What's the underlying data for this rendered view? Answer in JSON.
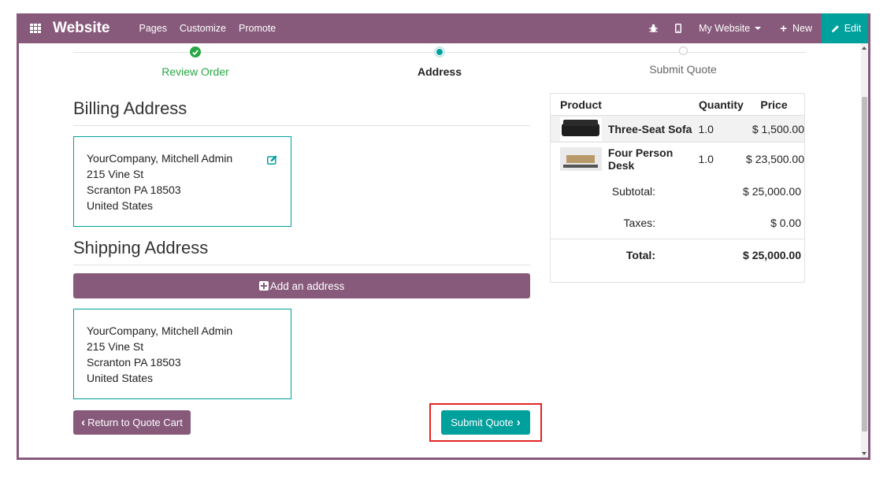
{
  "navbar": {
    "brand": "Website",
    "links": [
      "Pages",
      "Customize",
      "Promote"
    ],
    "site_select": "My Website",
    "new_label": "New",
    "edit_label": "Edit"
  },
  "steps": [
    {
      "label": "Review Order",
      "state": "done"
    },
    {
      "label": "Address",
      "state": "active"
    },
    {
      "label": "Submit Quote",
      "state": "todo"
    }
  ],
  "billing": {
    "title": "Billing Address",
    "lines": [
      "YourCompany, Mitchell Admin",
      "215 Vine St",
      "Scranton PA 18503",
      "United States"
    ]
  },
  "shipping": {
    "title": "Shipping Address",
    "add_label": "Add an address",
    "lines": [
      "YourCompany, Mitchell Admin",
      "215 Vine St",
      "Scranton PA 18503",
      "United States"
    ]
  },
  "actions": {
    "return_label": "Return to Quote Cart",
    "submit_label": "Submit Quote"
  },
  "summary": {
    "headers": {
      "product": "Product",
      "quantity": "Quantity",
      "price": "Price"
    },
    "items": [
      {
        "name": "Three-Seat Sofa",
        "qty": "1.0",
        "price": "$ 1,500.00"
      },
      {
        "name": "Four Person Desk",
        "qty": "1.0",
        "price": "$ 23,500.00"
      }
    ],
    "subtotal_label": "Subtotal:",
    "subtotal": "$ 25,000.00",
    "taxes_label": "Taxes:",
    "taxes": "$ 0.00",
    "total_label": "Total:",
    "total": "$ 25,000.00"
  },
  "colors": {
    "brand": "#875a7b",
    "accent": "#00a09d",
    "success": "#28a745",
    "highlight": "#e32424"
  }
}
